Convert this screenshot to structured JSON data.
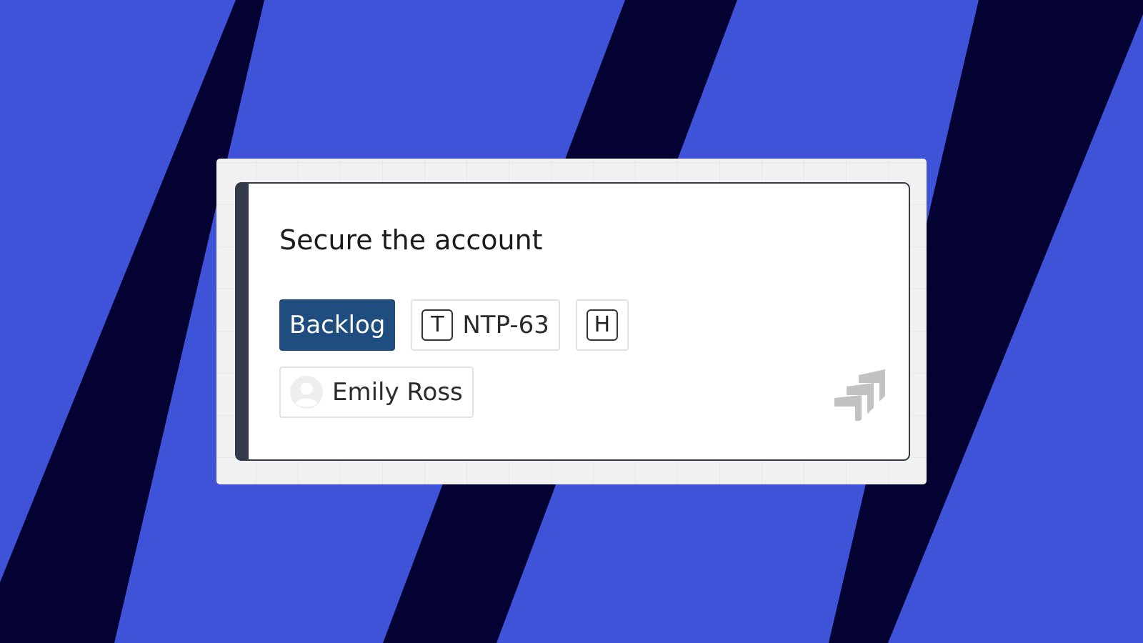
{
  "colors": {
    "background_primary": "#3f53d8",
    "background_stripe": "#030233",
    "card_accent": "#333a4a",
    "status_background": "#1f4d80",
    "status_text": "#ffffff"
  },
  "card": {
    "title": "Secure the account",
    "status": {
      "label": "Backlog"
    },
    "issue": {
      "type_icon_letter": "T",
      "key": "NTP-63"
    },
    "priority": {
      "icon_letter": "H"
    },
    "assignee": {
      "name": "Emily Ross",
      "avatar_icon": "default-user-avatar-icon"
    },
    "logo_icon": "jira-logo-icon"
  }
}
